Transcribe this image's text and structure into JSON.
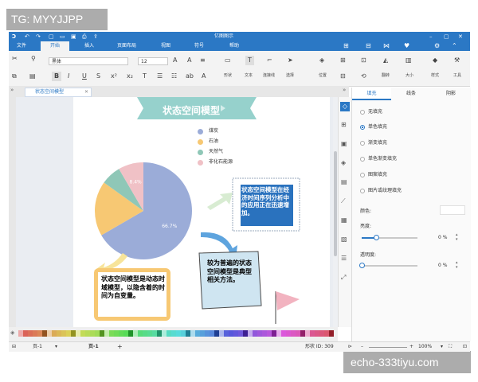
{
  "watermark_top": "TG: MYYJJPP",
  "watermark_bottom": "echo-333tiyu.com",
  "app": {
    "title": "亿图图示"
  },
  "menu": [
    "文件",
    "开始",
    "插入",
    "页面布局",
    "视图",
    "符号",
    "帮助"
  ],
  "ribbon": {
    "font_name": "黑体",
    "font_size": "12",
    "labels": [
      "形状",
      "文本",
      "连接线",
      "选择",
      "位置",
      "翻转",
      "大小",
      "样式",
      "工具"
    ]
  },
  "document_tab": "状态空间模型",
  "diagram": {
    "title": "状态空间模型",
    "note_right": "状态空间模型在经济时间序列分析中的应用正在迅速增加。",
    "note_bottom_left": "状态空间模型是动态时域模型，以隐含着的时间为自变量。",
    "note_bottom_center": "较为普遍的状态空间模型是典型相关方法。"
  },
  "chart_data": {
    "type": "pie",
    "categories": [
      "煤炭",
      "石油",
      "天然气",
      "非化石能源"
    ],
    "values": [
      66.7,
      18.3,
      6.7,
      8.4
    ],
    "labels": [
      "66.7%",
      "",
      "",
      "8.4%"
    ],
    "colors": [
      "#9bacd8",
      "#f7c873",
      "#8fc7b7",
      "#f0c1c6"
    ]
  },
  "panel": {
    "tabs": [
      "填充",
      "线条",
      "阴影"
    ],
    "fill_options": [
      "无填充",
      "单色填充",
      "渐变填充",
      "单色渐变填充",
      "图案填充",
      "图片或纹理填充"
    ],
    "selected_index": 1,
    "color_label": "颜色:",
    "brightness_label": "亮度:",
    "brightness_value": "0 %",
    "brightness_level": 0.25,
    "transparency_label": "透明度:",
    "transparency_value": "0 %",
    "transparency_level": 0
  },
  "status": {
    "page_selector": "页-1",
    "page_tab": "页-1",
    "add_page": "+",
    "shape_id": "形状 ID: 309",
    "zoom": "100%"
  },
  "colors": {
    "accent": "#2b78c5",
    "banner": "#96d1cc",
    "note_right_fill": "#2a72be",
    "note_bottom_left_border": "#f7c873",
    "note_bottom_center_fill": "#cfe5f1"
  }
}
